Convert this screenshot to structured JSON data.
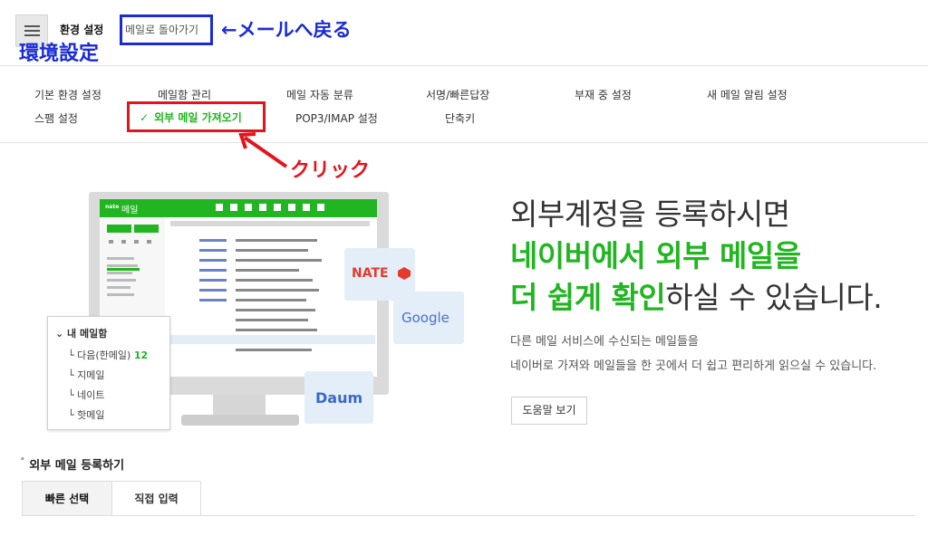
{
  "header": {
    "title": "환경 설정",
    "back_link": "메일로 돌아가기"
  },
  "annotations": {
    "back_note": "←メールへ戻る",
    "settings_note": "環境設定",
    "click_note": "クリック"
  },
  "nav": {
    "row1": [
      "기본 환경 설정",
      "메일함 관리",
      "메일 자동 분류",
      "서명/빠른답장",
      "부재 중 설정",
      "새 메일 알림 설정"
    ],
    "row2": [
      "스팸 설정",
      "외부 메일 가져오기",
      "POP3/IMAP 설정",
      "단축키"
    ],
    "active_check": "✓"
  },
  "hero": {
    "line1": "외부계정을 등록하시면",
    "line2": "네이버에서 외부 메일을",
    "line3_green": "더 쉽게 확인",
    "line3_rest": "하실 수 있습니다.",
    "desc1": "다른 메일 서비스에 수신되는 메일들을",
    "desc2": "네이버로 가져와 메일들을 한 곳에서 더 쉽고 편리하게 읽으실 수 있습니다.",
    "help_button": "도움말 보기"
  },
  "illustration": {
    "app_name": "메일",
    "brand_small": "nate",
    "folder_title": "내 메일함",
    "folders": [
      "다음(한메일)",
      "지메일",
      "네이트",
      "핫메일"
    ],
    "folder_count": "12",
    "brands": [
      "NATE",
      "Google",
      "Daum"
    ]
  },
  "register": {
    "title": "외부 메일 등록하기",
    "tabs": [
      "빠른 선택",
      "직접 입력"
    ]
  },
  "colors": {
    "green": "#21b521",
    "annotation_blue": "#1a2bd6",
    "annotation_red": "#e4141d"
  }
}
